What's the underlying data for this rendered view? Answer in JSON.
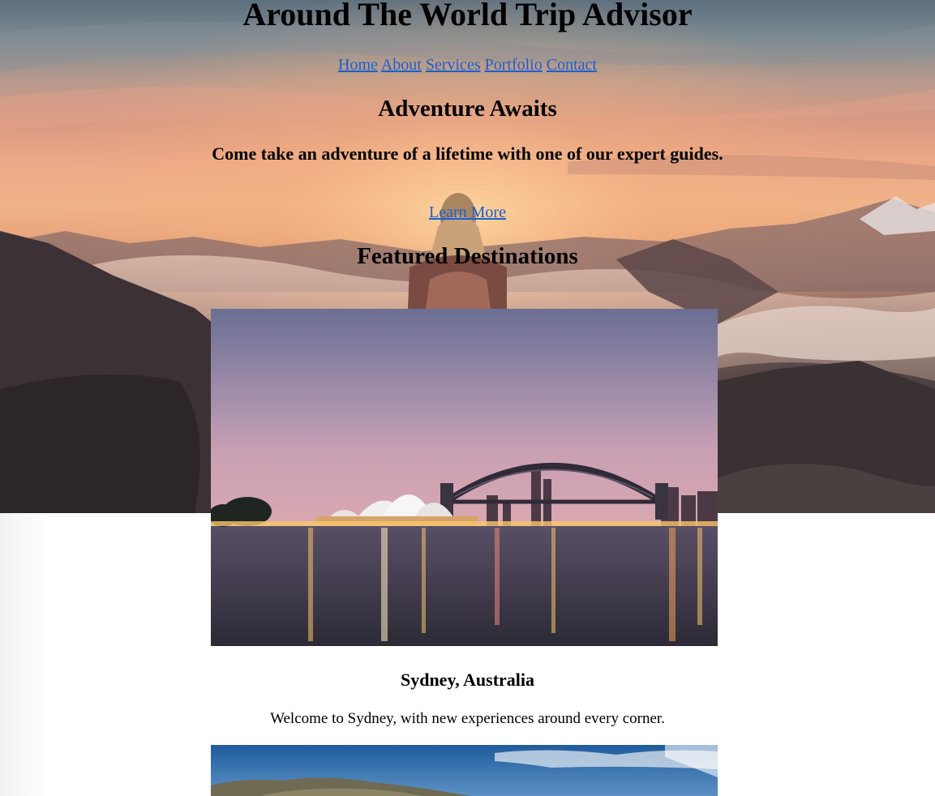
{
  "header": {
    "title": "Around The World Trip Advisor"
  },
  "nav": {
    "items": [
      "Home",
      "About",
      "Services",
      "Portfolio",
      "Contact"
    ]
  },
  "hero": {
    "heading": "Adventure Awaits",
    "subtitle": "Come take an adventure of a lifetime with one of our expert guides.",
    "cta_label": "Learn More"
  },
  "featured": {
    "heading": "Featured Destinations",
    "destinations": [
      {
        "name": "Sydney, Australia",
        "description": "Welcome to Sydney, with new experiences around every corner."
      }
    ]
  },
  "colors": {
    "link": "#1a5fd0",
    "text": "#000000",
    "background": "#ffffff"
  }
}
